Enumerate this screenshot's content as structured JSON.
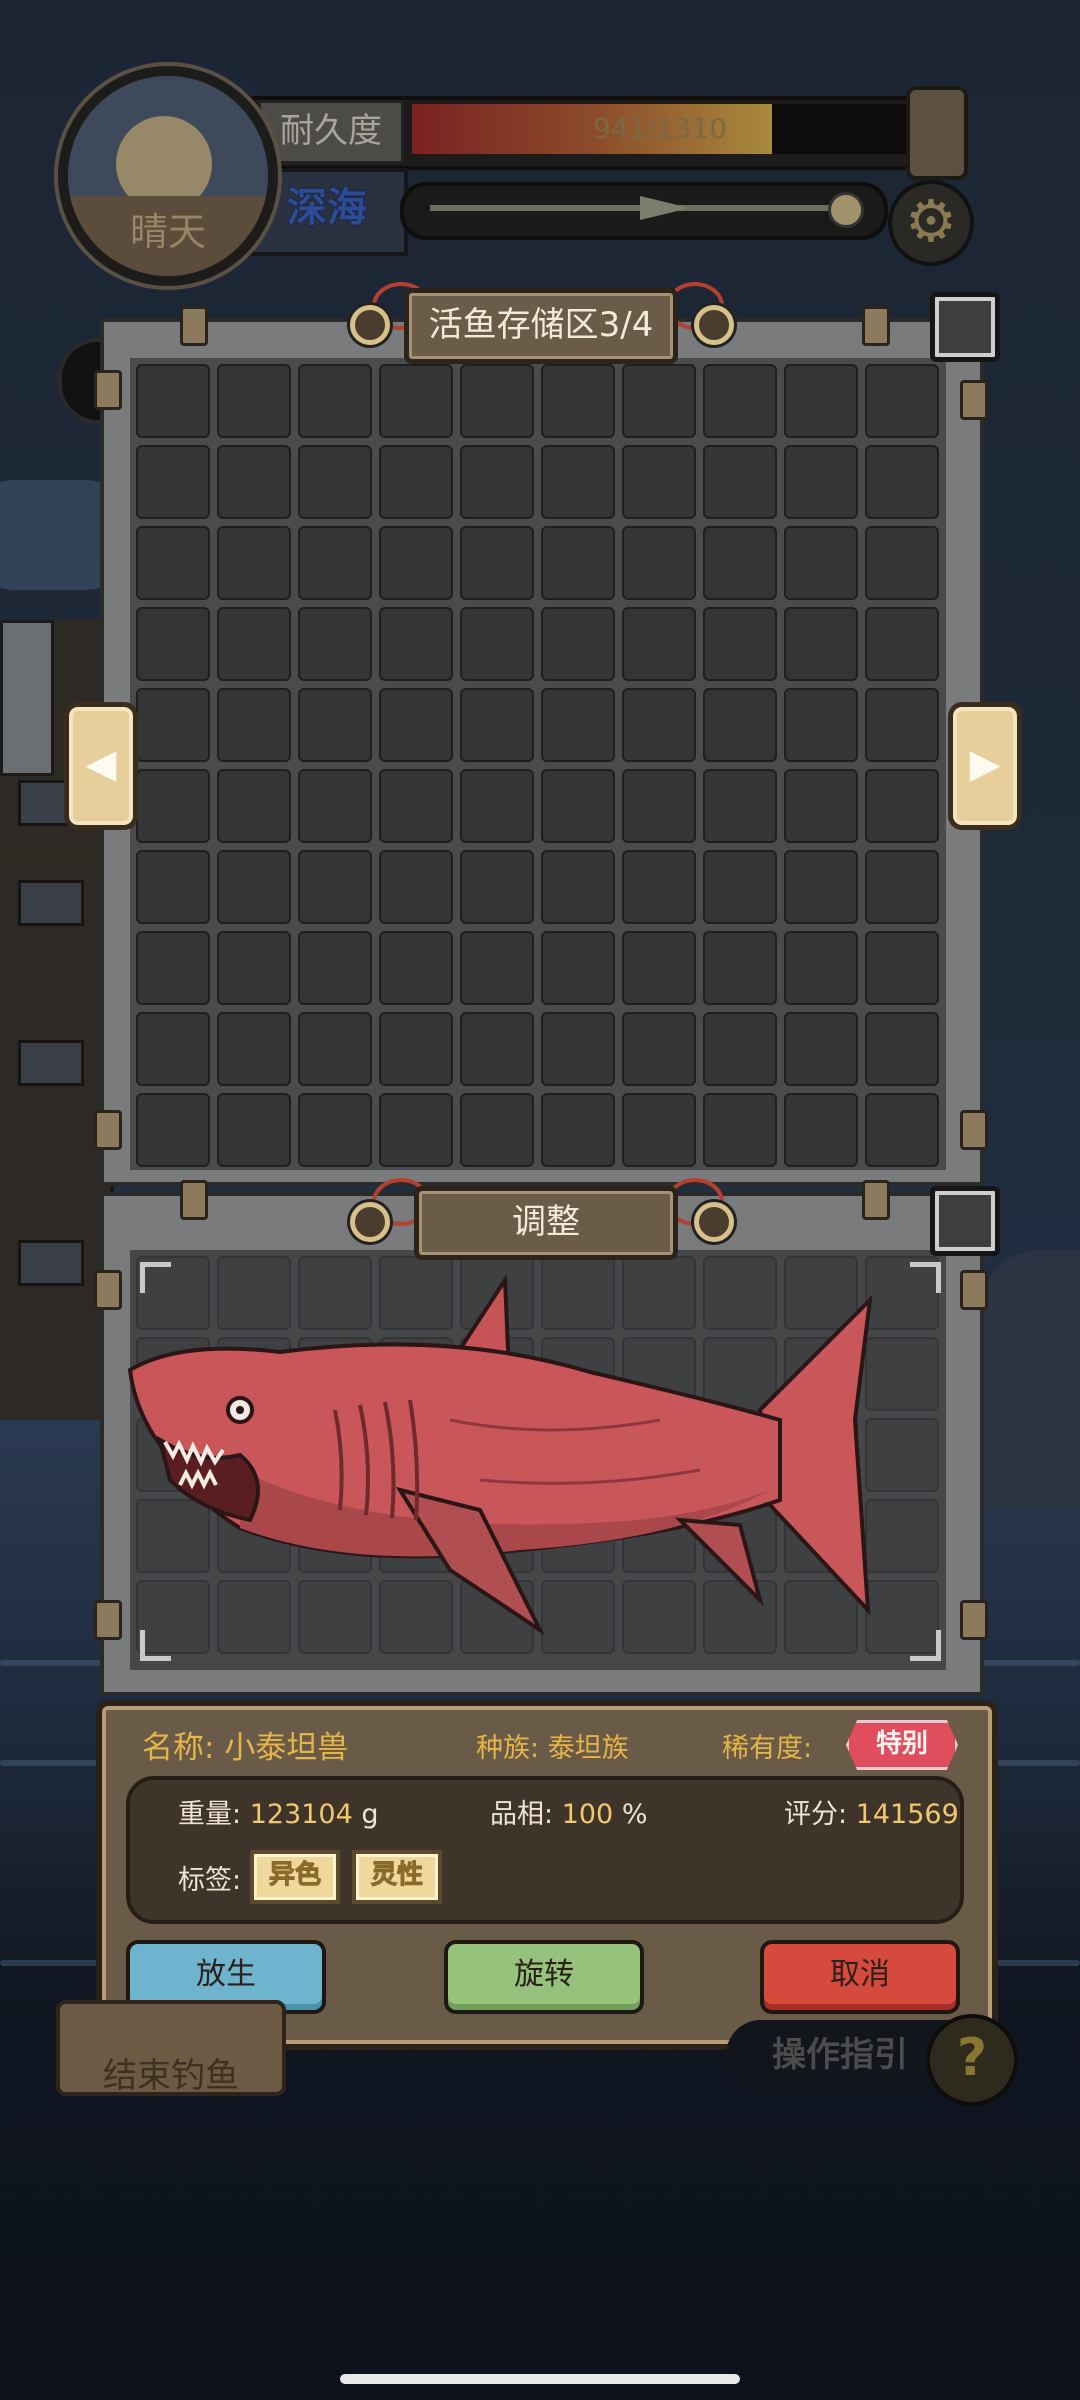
{
  "hud": {
    "weather": "晴天",
    "durability_label": "耐久度",
    "durability_value": "941/1310",
    "durability_fraction": 0.72,
    "depth_label": "深海",
    "settings_icon": "gear-icon"
  },
  "storage": {
    "title": "活鱼存储区3/4",
    "rows": 10,
    "cols": 10,
    "prev_icon": "arrow-left-icon",
    "next_icon": "arrow-right-icon"
  },
  "adjust": {
    "title": "调整",
    "rows": 5,
    "cols": 10
  },
  "fish": {
    "name_label": "名称: ",
    "name": "小泰坦兽",
    "race_label": "种族: ",
    "race": "泰坦族",
    "rarity_label": "稀有度:",
    "rarity": "特别",
    "weight_label": "重量: ",
    "weight": "123104",
    "weight_unit": " g",
    "quality_label": "品相: ",
    "quality": "100",
    "quality_unit": " %",
    "score_label": "评分: ",
    "score": "141569",
    "tags_label": "标签:",
    "tags": [
      "异色",
      "灵性"
    ],
    "color": "#c9575a"
  },
  "actions": {
    "release": "放生",
    "rotate": "旋转",
    "cancel": "取消"
  },
  "footer": {
    "end_fishing": "结束钓鱼",
    "guide": "操作指引",
    "help_icon": "?"
  }
}
